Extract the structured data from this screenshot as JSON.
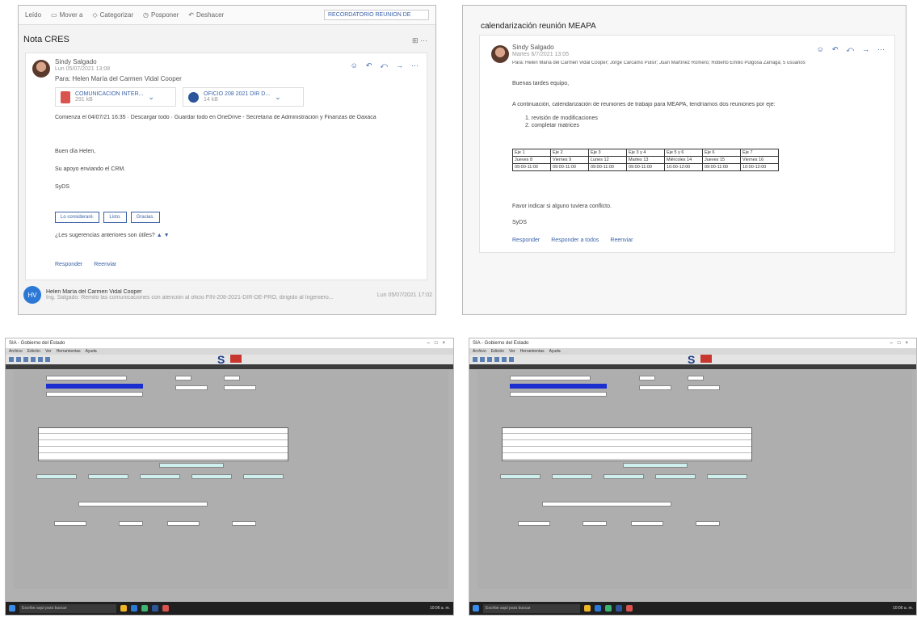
{
  "panel1": {
    "toolbar": {
      "left_label": "Leído",
      "move_label": "Mover a",
      "categorize_label": "Categorizar",
      "pospone_label": "Posponer",
      "undo_label": "Deshacer",
      "search_text": "RECORDATORIO REUNION DE"
    },
    "subject": "Nota CRES",
    "sender_name": "Sindy Salgado",
    "sender_date": "Lun 05/07/2021 13:08",
    "recipients": "Para: Helen María del Carmen Vidal Cooper",
    "attachments": [
      {
        "name": "COMUNICACION INTER...",
        "size": "291 kB"
      },
      {
        "name": "OFICIO 208 2021 DIR D...",
        "size": "14 kB"
      }
    ],
    "link_line": "Comienza el 04/07/21 16:35 · Descargar todo · Guardar todo en OneDrive - Secretaría de Administración y Finanzas de Oaxaca",
    "greeting": "Buen día Helen,",
    "support": "Su apoyo enviando el CRM.",
    "signoff": "SyDS",
    "suggestions": [
      "Lo consideraré.",
      "Listo.",
      "Gracias."
    ],
    "feedback": "¿Les sugerencias anteriores son útiles?",
    "reply_label": "Responder",
    "forward_label": "Reenviar",
    "footer_initials": "HV",
    "footer_name": "Helen María del Carmen Vidal Cooper",
    "footer_preview": "Ing. Salgado: Remito las comunicaciones con atención al oficio FIN-208-2021-DIR-DE-PRO, dirigido al Ingeniero...",
    "footer_date": "Lun 05/07/2021 17:02"
  },
  "panel2": {
    "subject": "calendarización reunión MEAPA",
    "sender_name": "Sindy Salgado",
    "sender_date": "Martes 6/7/2021 13:05",
    "recipients": "Para: Helen María del Carmen Vidal Cooper; Jorge Cárcamo Pulsir; Juan Martínez Romero; Roberto Emilio Pulgosa Zarraga; 5 usuarios",
    "greeting": "Buenas tardes equipo,",
    "intro": "A continuación, calendarización de reuniones de trabajo para MEAPA, tendríamos dos reuniones por eje:",
    "list": [
      "1. revisión de modificaciones",
      "2. completar matrices"
    ],
    "table": [
      [
        "Eje 1",
        "Eje 2",
        "Eje 3",
        "Eje 3 y 4",
        "Eje 5 y 6",
        "Eje 6",
        "Eje 7"
      ],
      [
        "Jueves 8",
        "Viernes 9",
        "Lunes 12",
        "Martes 13",
        "Miércoles 14",
        "Jueves 15",
        "Viernes 16"
      ],
      [
        "09:00-11:00",
        "09:00-11:00",
        "09:00-11:00",
        "09:00-11:00",
        "10:00-12:00",
        "09:00-11:00",
        "10:00-12:00"
      ]
    ],
    "closing": "Favor indicar si alguno tuviera conflicto.",
    "signoff": "SyDS",
    "reply_label": "Responder",
    "reply_all_label": "Responder a todos",
    "forward_label": "Reenviar"
  },
  "panel3": {
    "window_title": "SIA - Gobierno del Estado",
    "menu": [
      "Archivo",
      "Edición",
      "Ver",
      "Herramientas",
      "Ayuda"
    ],
    "taskbar_search": "Escribe aquí para buscar",
    "clock": "10:06 a. m."
  },
  "panel4": {
    "window_title": "SIA - Gobierno del Estado",
    "menu": [
      "Archivo",
      "Edición",
      "Ver",
      "Herramientas",
      "Ayuda"
    ],
    "taskbar_search": "Escribe aquí para buscar",
    "clock": "10:06 a. m."
  }
}
